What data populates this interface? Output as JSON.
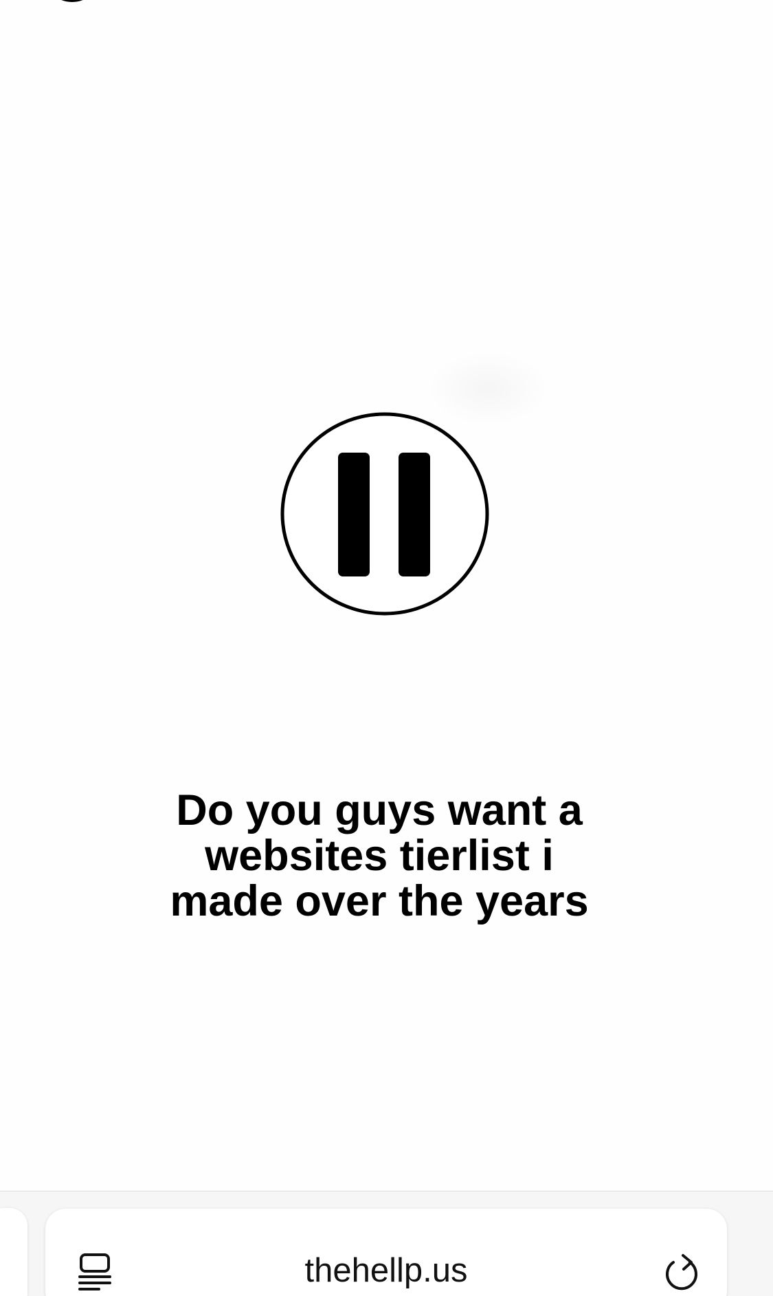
{
  "content": {
    "caption_lines": [
      "Do you guys want a",
      "websites tierlist i",
      "made over the years"
    ]
  },
  "icons": {
    "pause": "pause-icon",
    "reader": "reader-mode-icon",
    "reload": "reload-icon"
  },
  "toolbar": {
    "url": "thehellp.us"
  },
  "colors": {
    "text": "#000000",
    "toolbar_bg": "#f6f6f7",
    "address_bar_bg": "#ffffff"
  }
}
